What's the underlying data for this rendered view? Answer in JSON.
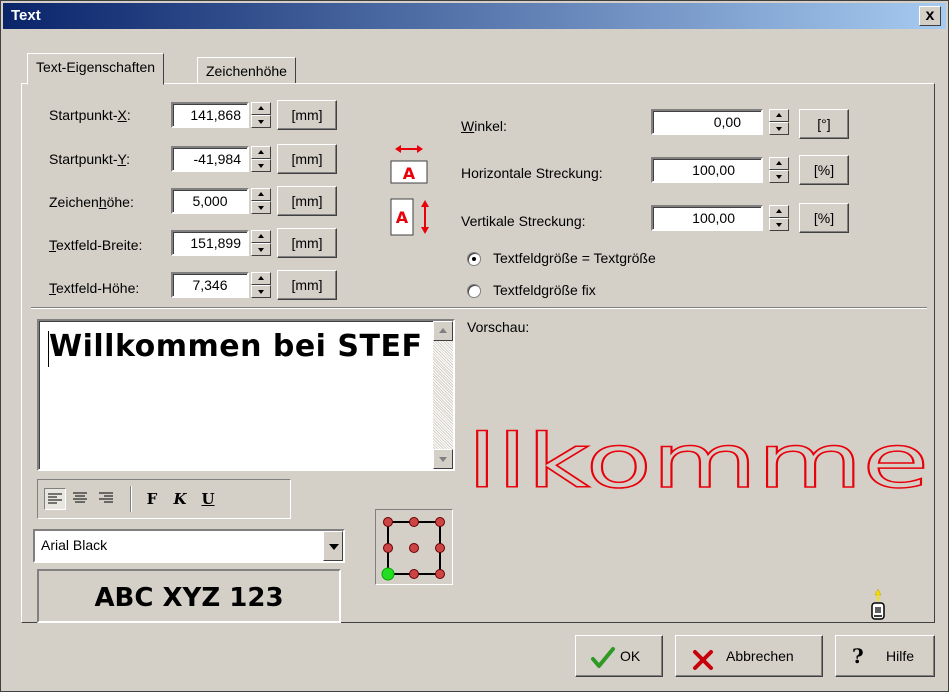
{
  "window": {
    "title": "Text",
    "close_glyph": "x"
  },
  "tabs": [
    {
      "label": "Text-Eigenschaften",
      "active": true
    },
    {
      "label": "Zeichenhöhe",
      "active": false
    }
  ],
  "fields": {
    "startx": {
      "label_pre": "Startpunkt-",
      "label_u": "X",
      "label_post": ":",
      "value": "141,868",
      "unit": "[mm]"
    },
    "starty": {
      "label_pre": "Startpunkt-",
      "label_u": "Y",
      "label_post": ":",
      "value": "-41,984",
      "unit": "[mm]"
    },
    "charh": {
      "label_pre": "Zeichen",
      "label_u": "h",
      "label_post": "öhe:",
      "value": "5,000",
      "unit": "[mm]"
    },
    "tfw": {
      "label_pre": "",
      "label_u": "T",
      "label_post": "extfeld-Breite:",
      "value": "151,899",
      "unit": "[mm]"
    },
    "tfh": {
      "label_pre": "",
      "label_u": "T",
      "label_post": "extfeld-Höhe:",
      "value": "7,346",
      "unit": "[mm]"
    }
  },
  "right_fields": {
    "angle": {
      "label_u": "W",
      "label_post": "inkel:",
      "value": "0,00",
      "unit": "[°]"
    },
    "hstretch": {
      "label": "Horizontale Streckung:",
      "value": "100,00",
      "unit": "[%]"
    },
    "vstretch": {
      "label": "Vertikale Streckung:",
      "value": "100,00",
      "unit": "[%]"
    }
  },
  "radios": [
    {
      "label": "Textfeldgröße = Textgröße",
      "checked": true
    },
    {
      "label": "Textfeldgröße fix",
      "checked": false
    }
  ],
  "editor": {
    "text": "Willkommen bei STEF"
  },
  "preview": {
    "label": "Vorschau:",
    "text": "llkomme",
    "color": "#e8000b"
  },
  "format_toolbar": {
    "bold": "F",
    "italic": "K",
    "underline": "U"
  },
  "font": {
    "name": "Arial Black",
    "sample": "ABC XYZ 123"
  },
  "icons": {
    "anchor_point": "bottom-left",
    "anchor_color": "#22dd22",
    "handle_color": "#cc4444"
  },
  "buttons": {
    "ok": "OK",
    "cancel": "Abbrechen",
    "help": "Hilfe"
  }
}
